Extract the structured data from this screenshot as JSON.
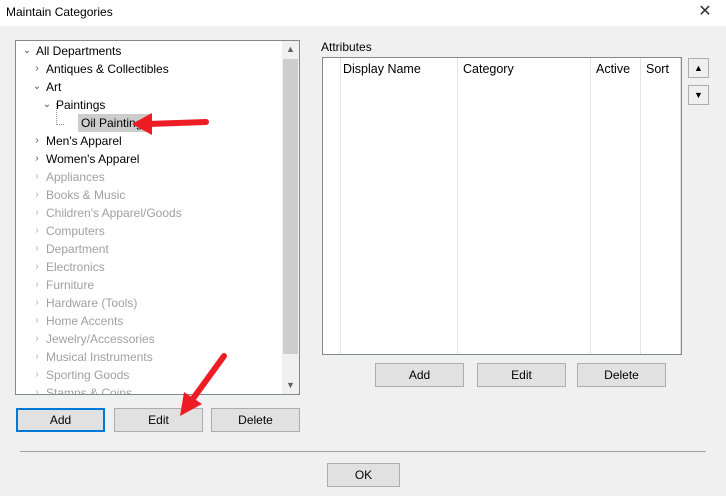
{
  "window": {
    "title": "Maintain Categories",
    "close_glyph": "✕"
  },
  "tree": {
    "nodes": [
      {
        "label": "All Departments",
        "expander": "⌄",
        "disabled": false
      },
      {
        "label": "Antiques & Collectibles",
        "expander": "›",
        "disabled": false
      },
      {
        "label": "Art",
        "expander": "⌄",
        "disabled": false
      },
      {
        "label": "Paintings",
        "expander": "⌄",
        "disabled": false
      },
      {
        "label": "Oil Paintings",
        "expander": "",
        "disabled": false,
        "selected": true
      },
      {
        "label": "Men's Apparel",
        "expander": "›",
        "disabled": false
      },
      {
        "label": "Women's Apparel",
        "expander": "›",
        "disabled": false
      },
      {
        "label": "Appliances",
        "expander": "›",
        "disabled": true
      },
      {
        "label": "Books & Music",
        "expander": "›",
        "disabled": true
      },
      {
        "label": "Children's Apparel/Goods",
        "expander": "›",
        "disabled": true
      },
      {
        "label": "Computers",
        "expander": "›",
        "disabled": true
      },
      {
        "label": "Department",
        "expander": "›",
        "disabled": true
      },
      {
        "label": "Electronics",
        "expander": "›",
        "disabled": true
      },
      {
        "label": "Furniture",
        "expander": "›",
        "disabled": true
      },
      {
        "label": "Hardware (Tools)",
        "expander": "›",
        "disabled": true
      },
      {
        "label": "Home Accents",
        "expander": "›",
        "disabled": true
      },
      {
        "label": "Jewelry/Accessories",
        "expander": "›",
        "disabled": true
      },
      {
        "label": "Musical Instruments",
        "expander": "›",
        "disabled": true
      },
      {
        "label": "Sporting Goods",
        "expander": "›",
        "disabled": true
      },
      {
        "label": "Stamps & Coins",
        "expander": "›",
        "disabled": true
      }
    ]
  },
  "tree_buttons": {
    "add": "Add",
    "edit": "Edit",
    "delete": "Delete"
  },
  "attributes": {
    "label": "Attributes",
    "columns": [
      "Display Name",
      "Category",
      "Active",
      "Sort"
    ],
    "buttons": {
      "add": "Add",
      "edit": "Edit",
      "delete": "Delete"
    },
    "move_up_glyph": "▲",
    "move_down_glyph": "▼"
  },
  "footer": {
    "ok": "OK"
  },
  "colors": {
    "annotation_arrow": "#ee1c24",
    "selection": "#cccccc",
    "default_button_border": "#0078d7"
  }
}
